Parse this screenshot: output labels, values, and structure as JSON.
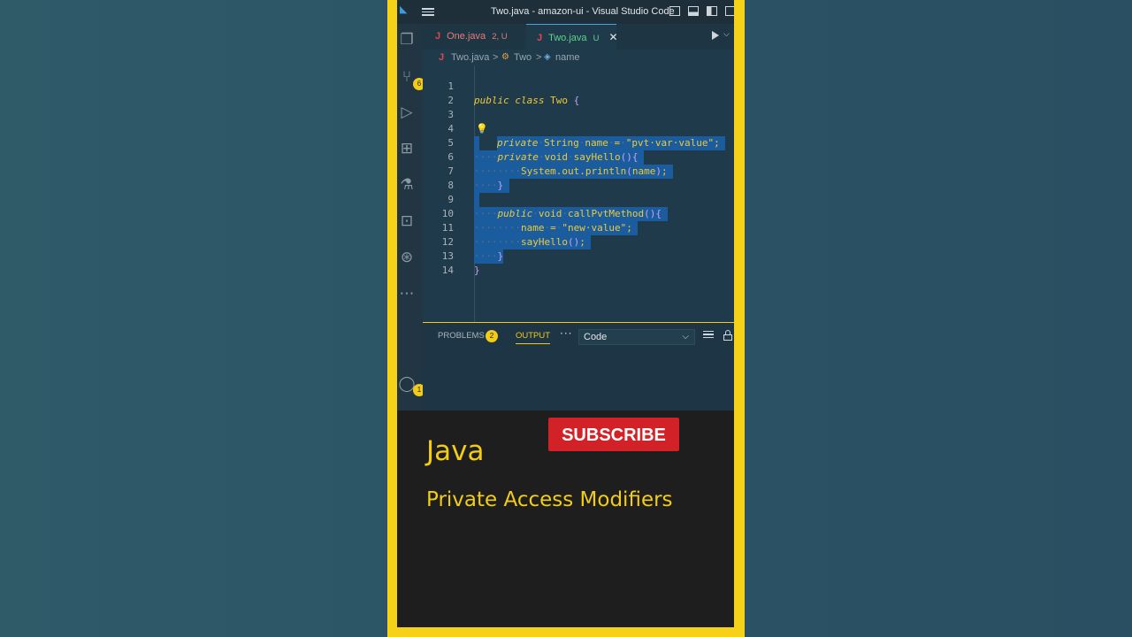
{
  "window": {
    "title": "Two.java - amazon-ui - Visual Studio Code"
  },
  "activity": {
    "source_control_badge": "6",
    "accounts_badge": "1"
  },
  "tabs": [
    {
      "icon": "J",
      "label": "One.java",
      "status": "2, U"
    },
    {
      "icon": "J",
      "label": "Two.java",
      "status": "U",
      "close": "✕"
    }
  ],
  "breadcrumb": {
    "icon": "J",
    "file": "Two.java",
    "sep": ">",
    "class_name": "Two",
    "field_name": "name"
  },
  "code": {
    "line_numbers": [
      "1",
      "2",
      "3",
      "4",
      "5",
      "6",
      "7",
      "8",
      "9",
      "10",
      "11",
      "12",
      "13",
      "14"
    ],
    "lines": [
      "public class Two {",
      "",
      "    private String name = \"pvt var value\";",
      "",
      "    private void sayHello(){",
      "        System.out.println(name);",
      "    }",
      "",
      "    public void callPvtMethod(){",
      "        name = \"new value\";",
      "        sayHello();",
      "    }",
      "}",
      ""
    ]
  },
  "panel": {
    "problems_label": "PROBLEMS",
    "problems_count": "2",
    "output_label": "OUTPUT",
    "more": "···",
    "output_channel": "Code"
  },
  "caption": {
    "subscribe_label": "SUBSCRIBE",
    "title": "Java",
    "subtitle": "Private Access Modifiers"
  },
  "colors": {
    "frame": "#f7d117",
    "selection": "#1a5c9e",
    "code_text": "#f2ca2e",
    "subscribe_button": "#d32128",
    "caption_text": "#f2cc17"
  }
}
